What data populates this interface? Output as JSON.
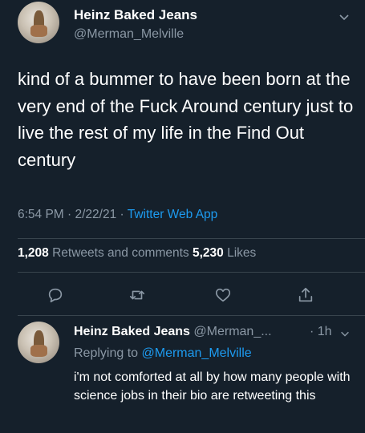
{
  "tweet": {
    "display_name": "Heinz Baked Jeans",
    "handle": "@Merman_Melville",
    "text": "kind of a bummer to have been born at the very end of the Fuck Around century just to live the rest of my life in the Find Out century",
    "time": "6:54 PM · 2/22/21 · ",
    "app": "Twitter Web App",
    "retweets_count": "1,208",
    "retweets_label": " Retweets and comments ",
    "likes_count": "5,230",
    "likes_label": " Likes"
  },
  "actions": {
    "reply_icon": "reply-icon",
    "retweet_icon": "retweet-icon",
    "like_icon": "heart-icon",
    "share_icon": "share-icon"
  },
  "reply": {
    "display_name": "Heinz Baked Jeans",
    "handle": " @Merman_...",
    "time": "· 1h",
    "replying_prefix": "Replying to ",
    "replying_to": "@Merman_Melville",
    "text": "i'm not comforted at all by how many people with science jobs in their bio are retweeting this"
  },
  "colors": {
    "background": "#15202b",
    "text": "#ffffff",
    "secondary": "#8b98a5",
    "accent": "#1d9bf0",
    "divider": "#38444d"
  }
}
